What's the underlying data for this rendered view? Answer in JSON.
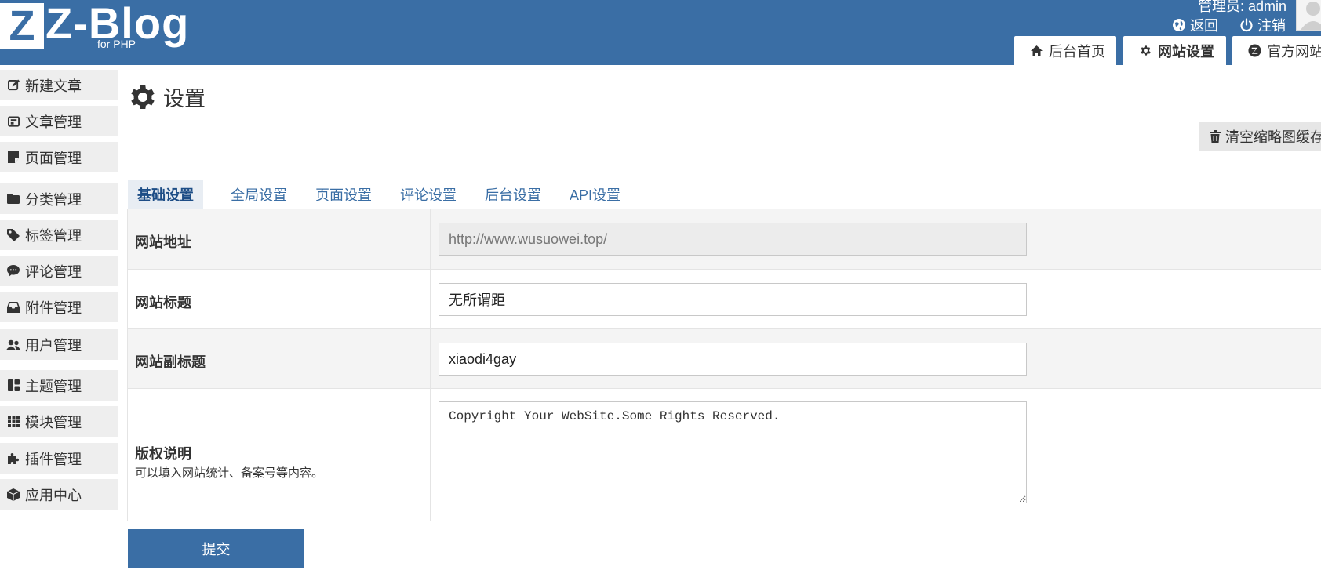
{
  "header": {
    "logo_mark": "Z",
    "logo_text": "Z-Blog",
    "logo_sub": "for PHP",
    "admin_label": "管理员: admin",
    "back_label": "返回",
    "logout_label": "注销",
    "tabs": [
      {
        "label": "后台首页",
        "icon": "home-icon"
      },
      {
        "label": "网站设置",
        "icon": "gear-icon"
      },
      {
        "label": "官方网站",
        "icon": "zblog-icon"
      }
    ],
    "colors": {
      "accent": "#3a6ea5"
    }
  },
  "sidebar": {
    "items": [
      {
        "label": "新建文章",
        "icon": "edit-icon"
      },
      {
        "label": "文章管理",
        "icon": "article-list-icon"
      },
      {
        "label": "页面管理",
        "icon": "page-icon"
      },
      {
        "label": "分类管理",
        "icon": "folder-icon"
      },
      {
        "label": "标签管理",
        "icon": "tag-icon"
      },
      {
        "label": "评论管理",
        "icon": "comment-icon"
      },
      {
        "label": "附件管理",
        "icon": "inbox-icon"
      },
      {
        "label": "用户管理",
        "icon": "users-icon"
      },
      {
        "label": "主题管理",
        "icon": "theme-icon"
      },
      {
        "label": "模块管理",
        "icon": "grid-icon"
      },
      {
        "label": "插件管理",
        "icon": "puzzle-icon"
      },
      {
        "label": "应用中心",
        "icon": "box-icon"
      }
    ]
  },
  "main": {
    "title": "设置",
    "clear_cache_label": "清空缩略图缓存",
    "tabs": [
      "基础设置",
      "全局设置",
      "页面设置",
      "评论设置",
      "后台设置",
      "API设置"
    ],
    "active_tab": "基础设置",
    "fields": {
      "site_url": {
        "label": "网站地址",
        "value": "http://www.wusuowei.top/"
      },
      "site_title": {
        "label": "网站标题",
        "value": "无所谓距"
      },
      "site_subtitle": {
        "label": "网站副标题",
        "value": "xiaodi4gay"
      },
      "copyright": {
        "label": "版权说明",
        "hint": "可以填入网站统计、备案号等内容。",
        "value": "Copyright Your WebSite.Some Rights Reserved."
      }
    },
    "submit_label": "提交"
  }
}
